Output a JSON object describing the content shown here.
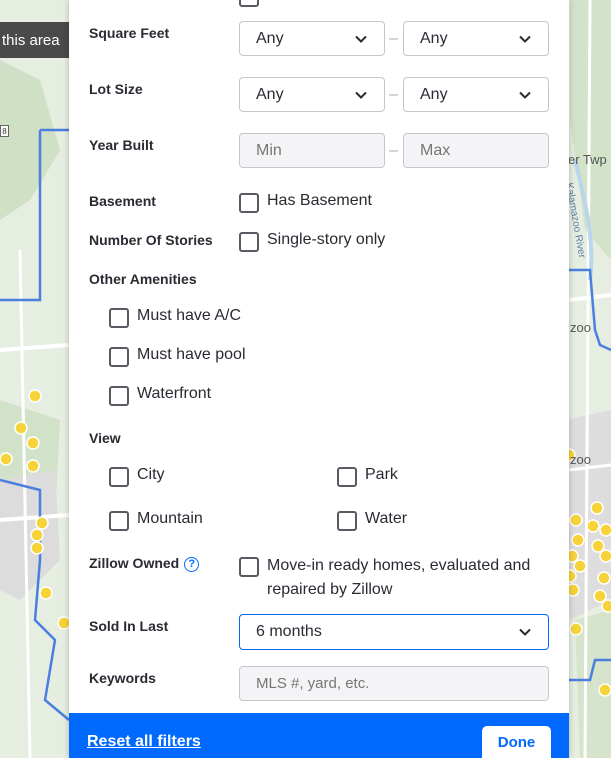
{
  "map": {
    "search_area_label": "this area",
    "highway_shield": "8",
    "place_labels": [
      "er Twp",
      "Kalamazoo River",
      "zoo",
      "zoo"
    ],
    "colors": {
      "boundary": "#4a7fe0",
      "marker": "#f7d33a",
      "water": "#b9d6ea"
    }
  },
  "filters": {
    "square_feet": {
      "label": "Square Feet",
      "min": "Any",
      "max": "Any"
    },
    "lot_size": {
      "label": "Lot Size",
      "min": "Any",
      "max": "Any"
    },
    "year_built": {
      "label": "Year Built",
      "min_placeholder": "Min",
      "max_placeholder": "Max"
    },
    "range_separator": "–",
    "basement": {
      "label": "Basement",
      "option": "Has Basement"
    },
    "stories": {
      "label": "Number Of Stories",
      "option": "Single-story only"
    },
    "amenities": {
      "label": "Other Amenities",
      "options": [
        "Must have A/C",
        "Must have pool",
        "Waterfront"
      ]
    },
    "view": {
      "label": "View",
      "options": [
        "City",
        "Park",
        "Mountain",
        "Water"
      ]
    },
    "zillow_owned": {
      "label": "Zillow Owned",
      "help": "?",
      "option_line1": "Move-in ready homes, evaluated and",
      "option_line2": "repaired by Zillow"
    },
    "sold_in_last": {
      "label": "Sold In Last",
      "value": "6 months"
    },
    "keywords": {
      "label": "Keywords",
      "placeholder": "MLS #, yard, etc."
    }
  },
  "footer": {
    "reset_label": "Reset all filters",
    "done_label": "Done",
    "color": "#006aff"
  }
}
